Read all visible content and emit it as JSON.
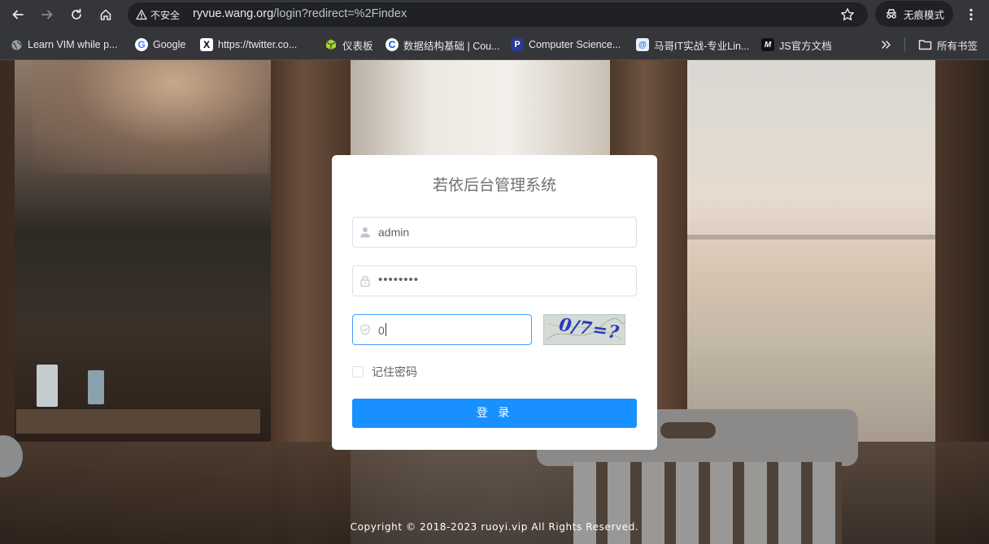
{
  "browser": {
    "url_host": "ryvue.wang.org",
    "url_path": "/login?redirect=%2Findex",
    "security_label": "不安全",
    "incognito_label": "无痕模式",
    "bookmarks": [
      {
        "label": "Learn VIM while p...",
        "icon": "globe-icon"
      },
      {
        "label": "Google",
        "icon": "google-icon"
      },
      {
        "label": "https://twitter.co...",
        "icon": "x-icon"
      },
      {
        "label": "仪表板",
        "icon": "cube-icon"
      },
      {
        "label": "数据结构基础 | Cou...",
        "icon": "coursera-icon"
      },
      {
        "label": "Computer Science...",
        "icon": "p-icon"
      },
      {
        "label": "马哥IT实战-专业Lin...",
        "icon": "mage-icon"
      },
      {
        "label": "JS官方文档",
        "icon": "mdn-icon"
      }
    ],
    "all_bookmarks_label": "所有书签"
  },
  "login": {
    "title": "若依后台管理系统",
    "username_value": "admin",
    "password_value": "••••••••",
    "code_value": "0",
    "captcha_text": "0/7=?",
    "remember_label": "记住密码",
    "submit_label": "登 录"
  },
  "footer": {
    "copyright": "Copyright © 2018-2023 ruoyi.vip All Rights Reserved."
  },
  "colors": {
    "primary": "#1890ff",
    "focus_border": "#409eff",
    "chrome_bg": "#35363a"
  }
}
